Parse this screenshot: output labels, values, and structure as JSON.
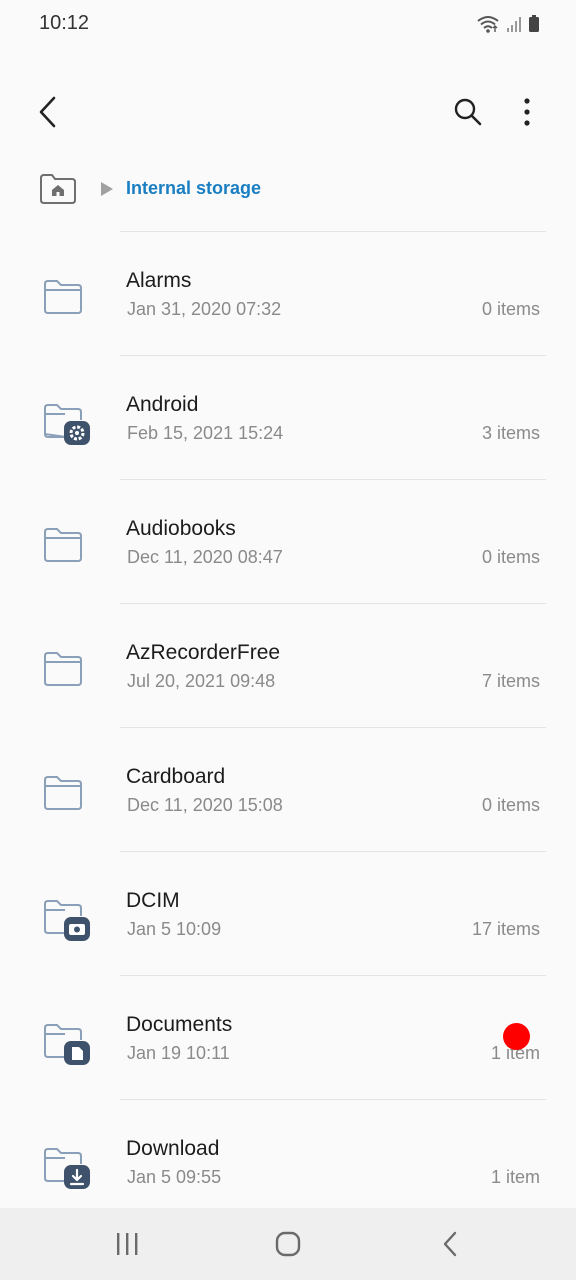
{
  "status_bar": {
    "time": "10:12",
    "icons": [
      "wifi-icon",
      "signal-icon",
      "battery-icon"
    ]
  },
  "app_bar": {
    "icons": [
      "back-arrow-icon",
      "search-icon",
      "more-vertical-icon"
    ]
  },
  "breadcrumb": {
    "home_icon": "home-folder-icon",
    "separator_icon": "triangle-right-icon",
    "current": "Internal storage",
    "accent_color": "#1a7fc2"
  },
  "files": [
    {
      "name": "Alarms",
      "date": "Jan 31, 2020 07:32",
      "count": "0 items",
      "icon": "folder-icon"
    },
    {
      "name": "Android",
      "date": "Feb 15, 2021 15:24",
      "count": "3 items",
      "icon": "folder-settings-icon"
    },
    {
      "name": "Audiobooks",
      "date": "Dec 11, 2020 08:47",
      "count": "0 items",
      "icon": "folder-icon"
    },
    {
      "name": "AzRecorderFree",
      "date": "Jul 20, 2021 09:48",
      "count": "7 items",
      "icon": "folder-icon"
    },
    {
      "name": "Cardboard",
      "date": "Dec 11, 2020 15:08",
      "count": "0 items",
      "icon": "folder-icon"
    },
    {
      "name": "DCIM",
      "date": "Jan 5 10:09",
      "count": "17 items",
      "icon": "folder-camera-icon"
    },
    {
      "name": "Documents",
      "date": "Jan 19 10:11",
      "count": "1 item",
      "icon": "folder-document-icon"
    },
    {
      "name": "Download",
      "date": "Jan 5 09:55",
      "count": "1 item",
      "icon": "folder-download-icon"
    }
  ],
  "nav_bar": {
    "icons": [
      "recent-apps-icon",
      "home-icon",
      "back-icon"
    ]
  },
  "colors": {
    "folder_outline": "#8aa0b8",
    "folder_badge": "#3e526b",
    "touch_indicator": "#ff0000"
  }
}
